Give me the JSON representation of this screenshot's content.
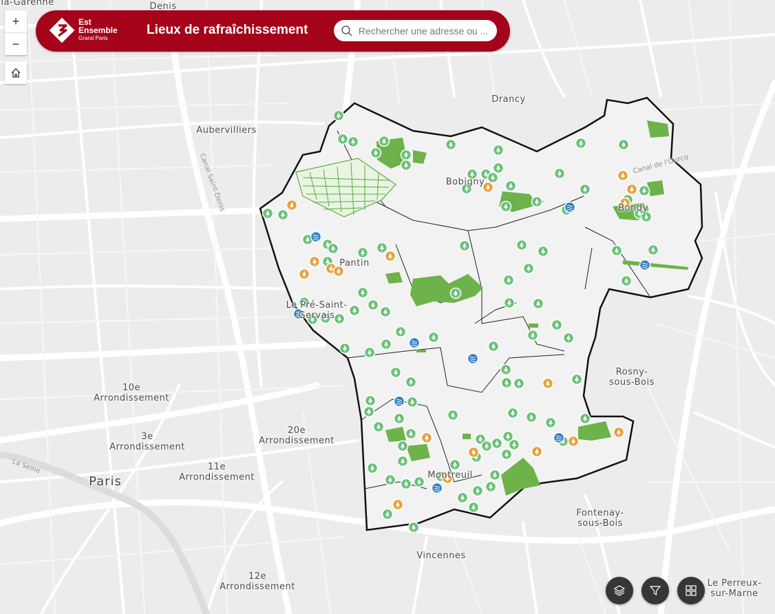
{
  "app": {
    "title": "Lieux de rafraîchissement",
    "logo_line1": "Est",
    "logo_line2": "Ensemble",
    "logo_line3": "Grand Paris",
    "brand_color": "#a4031a"
  },
  "search": {
    "placeholder": "Rechercher une adresse ou ..."
  },
  "controls": {
    "zoom_in": "+",
    "zoom_out": "−",
    "home_icon": "home-icon"
  },
  "widgets": [
    {
      "name": "layers-icon"
    },
    {
      "name": "filter-icon"
    },
    {
      "name": "basemap-gallery-icon"
    }
  ],
  "places": {
    "garenne": "la-Garenne",
    "denis": "Denis",
    "drancy": "Drancy",
    "aubervilliers": "Aubervilliers",
    "bobigny": "Bobigny",
    "bondy": "Bondy",
    "pantin": "Pantin",
    "pre_saint_gervais": "Le Pré-Saint-\nGervais",
    "rosny": "Rosny-\nsous-Bois",
    "arr10": "10e\nArrondissement",
    "arr3": "3e\nArrondissement",
    "arr20": "20e\nArrondissement",
    "arr11": "11e\nArrondissement",
    "paris": "Paris",
    "montreuil": "Montreuil",
    "fontenay": "Fontenay-\nsous-Bois",
    "vincennes": "Vincennes",
    "arr12": "12e\nArrondissement",
    "perreux": "Le Perreux-\nsur-Marne"
  },
  "streets": {
    "canal_saint_denis": "Canal Saint-Denis",
    "canal_ourcq": "Canal de l'Ourcq",
    "la_seine": "La Seine"
  },
  "legend_colors": {
    "green_space": "#6db24a",
    "park_marker": "#6bc178",
    "water_marker": "#2f7fc1",
    "shade_marker": "#e6a23c",
    "boundary": "#111111"
  }
}
